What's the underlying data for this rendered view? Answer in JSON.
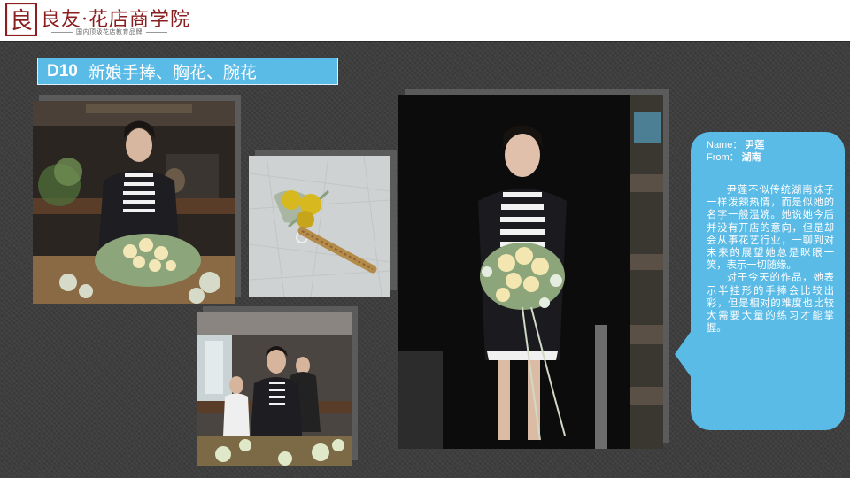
{
  "header": {
    "logo_glyph": "良",
    "brand_name": "良友·花店商学院",
    "tagline": "国内顶级花店教育品牌"
  },
  "title": {
    "code": "D10",
    "text": "新娘手捧、胸花、腕花"
  },
  "profile": {
    "name_label": "Name：",
    "name_value": "尹莲",
    "from_label": "From：",
    "from_value": "湖南",
    "paragraphs": [
      "尹莲不似传统湖南妹子一样泼辣热情，而是似她的名字一般温婉。她说她今后并没有开店的意向，但是却会从事花艺行业，一聊到对未来的展望她总是眯眼一笑，表示一切随缘。",
      "对于今天的作品，她表示半挂形的手捧会比较出彩，但是相对的难度也比较大需要大量的练习才能掌握。"
    ]
  },
  "colors": {
    "accent": "#5bbbe7",
    "brand": "#8a1f1f",
    "background": "#3c3c3c"
  }
}
